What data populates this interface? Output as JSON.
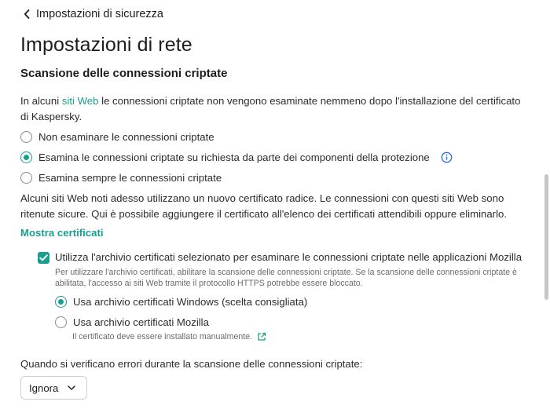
{
  "header": {
    "back_label": "Impostazioni di sicurezza",
    "page_title": "Impostazioni di rete"
  },
  "section": {
    "title": "Scansione delle connessioni criptate",
    "intro_before": "In alcuni ",
    "intro_link": "siti Web",
    "intro_after": " le connessioni criptate non vengono esaminate nemmeno dopo l'installazione del certificato di Kaspersky."
  },
  "scan_options": [
    {
      "label": "Non esaminare le connessioni criptate",
      "selected": false
    },
    {
      "label": "Esamina le connessioni criptate su richiesta da parte dei componenti della protezione",
      "selected": true
    },
    {
      "label": "Esamina sempre le connessioni criptate",
      "selected": false
    }
  ],
  "root_cert_note": "Alcuni siti Web noti adesso utilizzano un nuovo certificato radice. Le connessioni con questi siti Web sono ritenute sicure. Qui è possibile aggiungere il certificato all'elenco dei certificati attendibili oppure eliminarlo.",
  "show_certs_link": "Mostra certificati",
  "mozilla": {
    "checked": true,
    "label": "Utilizza l'archivio certificati selezionato per esaminare le connessioni criptate nelle applicazioni Mozilla",
    "description": "Per utilizzare l'archivio certificati, abilitare la scansione delle connessioni criptate. Se la scansione delle connessioni criptate è abilitata, l'accesso ai siti Web tramite il protocollo HTTPS potrebbe essere bloccato.",
    "store_options": [
      {
        "label": "Usa archivio certificati Windows (scelta consigliata)",
        "selected": true
      },
      {
        "label": "Usa archivio certificati Mozilla",
        "selected": false
      }
    ],
    "mozilla_note": "Il certificato deve essere installato manualmente."
  },
  "errors": {
    "label": "Quando si verificano errori durante la scansione delle connessioni criptate:",
    "selected_value": "Ignora"
  },
  "colors": {
    "accent": "#1a9e8f",
    "info": "#2a6fd6"
  },
  "icons": {
    "back": "chevron-left-icon",
    "info": "info-icon",
    "external": "external-link-icon",
    "dropdown": "chevron-down-icon"
  }
}
